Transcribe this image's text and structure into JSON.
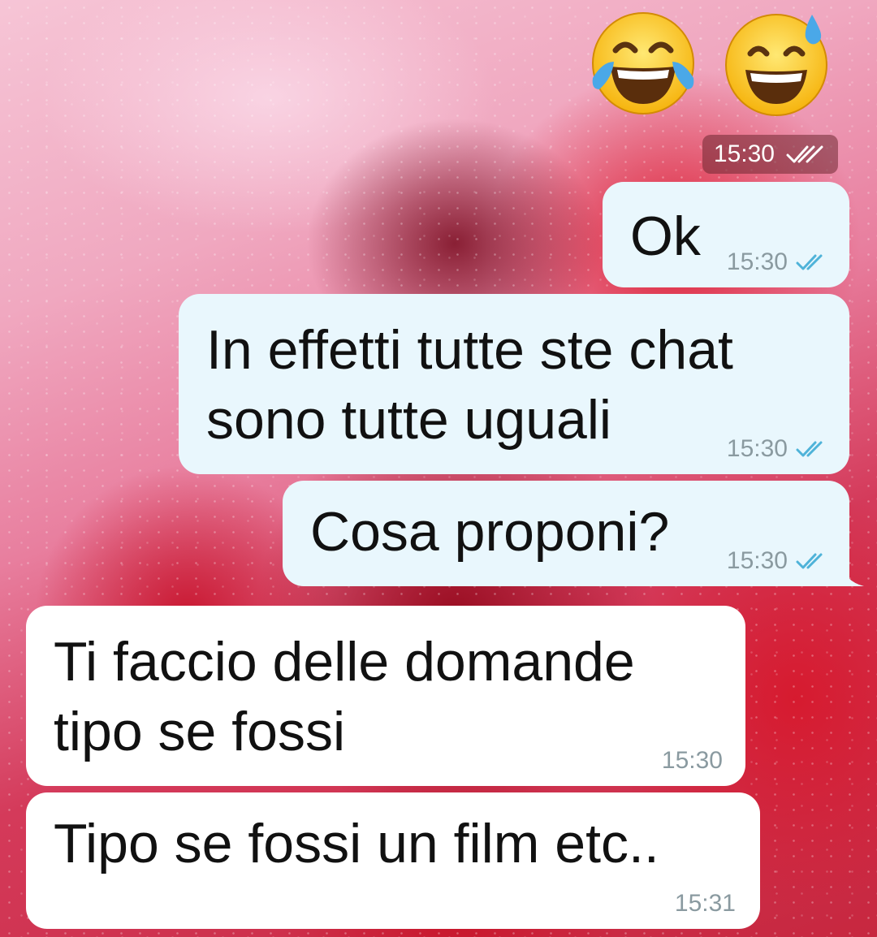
{
  "emojis": [
    {
      "icon": "face-with-tears-of-joy-icon"
    },
    {
      "icon": "grinning-face-with-sweat-icon"
    }
  ],
  "emoji_message": {
    "time": "15:30",
    "status_icon": "double-check-icon"
  },
  "messages": [
    {
      "direction": "outgoing",
      "text": "Ok",
      "time": "15:30",
      "status_icon": "double-check-read-icon"
    },
    {
      "direction": "outgoing",
      "text": "In effetti tutte ste chat\nsono tutte uguali",
      "time": "15:30",
      "status_icon": "double-check-read-icon"
    },
    {
      "direction": "outgoing",
      "text": "Cosa proponi?",
      "time": "15:30",
      "status_icon": "double-check-read-icon"
    },
    {
      "direction": "incoming",
      "text": "Ti faccio delle domande\ntipo se fossi",
      "time": "15:30"
    },
    {
      "direction": "incoming",
      "text": "Tipo se fossi un film etc..",
      "time": "15:31"
    }
  ],
  "colors": {
    "outgoing_bubble": "#e9f7fd",
    "incoming_bubble": "#ffffff",
    "read_check": "#4fb3d9",
    "timestamp": "#8a9aa0"
  }
}
